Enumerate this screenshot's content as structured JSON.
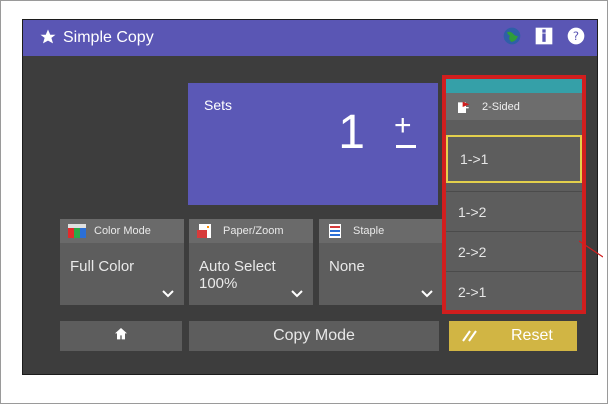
{
  "header": {
    "title": "Simple Copy"
  },
  "sets": {
    "label": "Sets",
    "count": "1",
    "plus": "+"
  },
  "settings": [
    {
      "name": "Color Mode",
      "value": "Full Color"
    },
    {
      "name": "Paper/Zoom",
      "value": "Auto Select",
      "value2": "100%"
    },
    {
      "name": "Staple",
      "value": "None"
    }
  ],
  "duplex": {
    "label": "2-Sided",
    "options": [
      "1->1",
      "1->2",
      "2->2",
      "2->1"
    ],
    "selected": "1->1"
  },
  "bottom": {
    "copy_mode": "Copy Mode",
    "reset": "Reset"
  },
  "colors": {
    "accent": "#5b58b6",
    "reset": "#d1b544",
    "highlight": "#d11e1e",
    "selected_border": "#e3d04c"
  }
}
